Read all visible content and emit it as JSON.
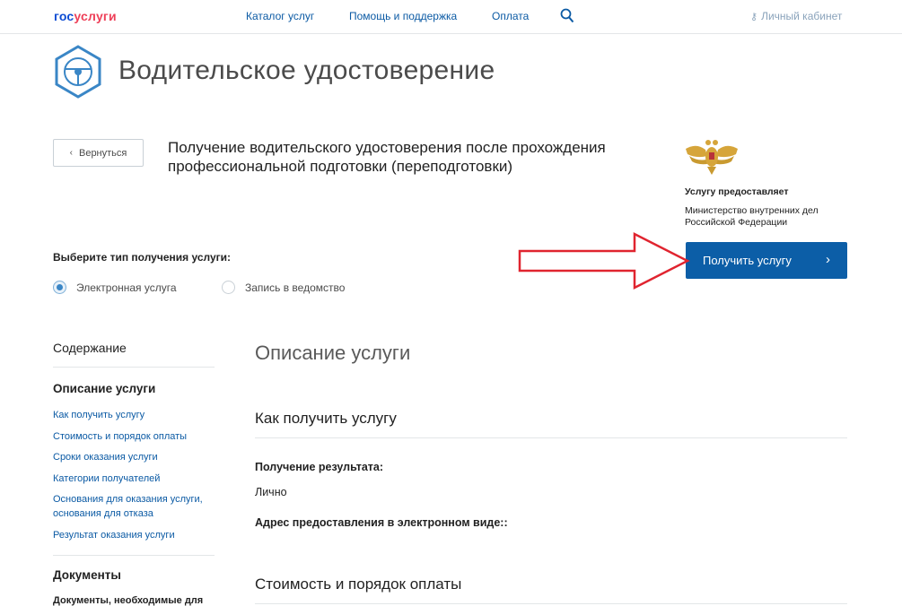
{
  "header": {
    "logo_part1": "гос",
    "logo_part2": "услуги",
    "nav": [
      "Каталог услуг",
      "Помощь и поддержка",
      "Оплата"
    ],
    "cabinet": "Личный кабинет"
  },
  "page": {
    "title": "Водительское удостоверение",
    "back_label": "Вернуться",
    "service_name": "Получение водительского удостоверения после прохождения профессиональной подготовки (переподготовки)"
  },
  "provider": {
    "heading": "Услугу предоставляет",
    "name": "Министерство внутренних дел Российской Федерации",
    "button_label": "Получить услугу"
  },
  "service_type": {
    "label": "Выберите тип получения услуги:",
    "options": [
      {
        "label": "Электронная услуга",
        "selected": true
      },
      {
        "label": "Запись в ведомство",
        "selected": false
      }
    ]
  },
  "sidebar": {
    "heading": "Содержание",
    "section1": "Описание услуги",
    "links": [
      "Как получить услугу",
      "Стоимость и порядок оплаты",
      "Сроки оказания услуги",
      "Категории получателей",
      "Основания для оказания услуги, основания для отказа",
      "Результат оказания услуги"
    ],
    "section2": "Документы",
    "section2_sub": "Документы, необходимые для"
  },
  "main": {
    "heading": "Описание услуги",
    "subheading1": "Как получить услугу",
    "result_label": "Получение результата:",
    "result_value": "Лично",
    "address_label": "Адрес предоставления в электронном виде::",
    "subheading2": "Стоимость и порядок оплаты"
  },
  "colors": {
    "accent": "#0c5ea7",
    "link": "#0b5aa4",
    "annotation_arrow": "#e0242f"
  },
  "icons": [
    "search-icon",
    "key-icon",
    "steering-wheel-icon",
    "chevron-left-icon",
    "chevron-right-icon",
    "emblem-icon",
    "arrow-annotation"
  ]
}
